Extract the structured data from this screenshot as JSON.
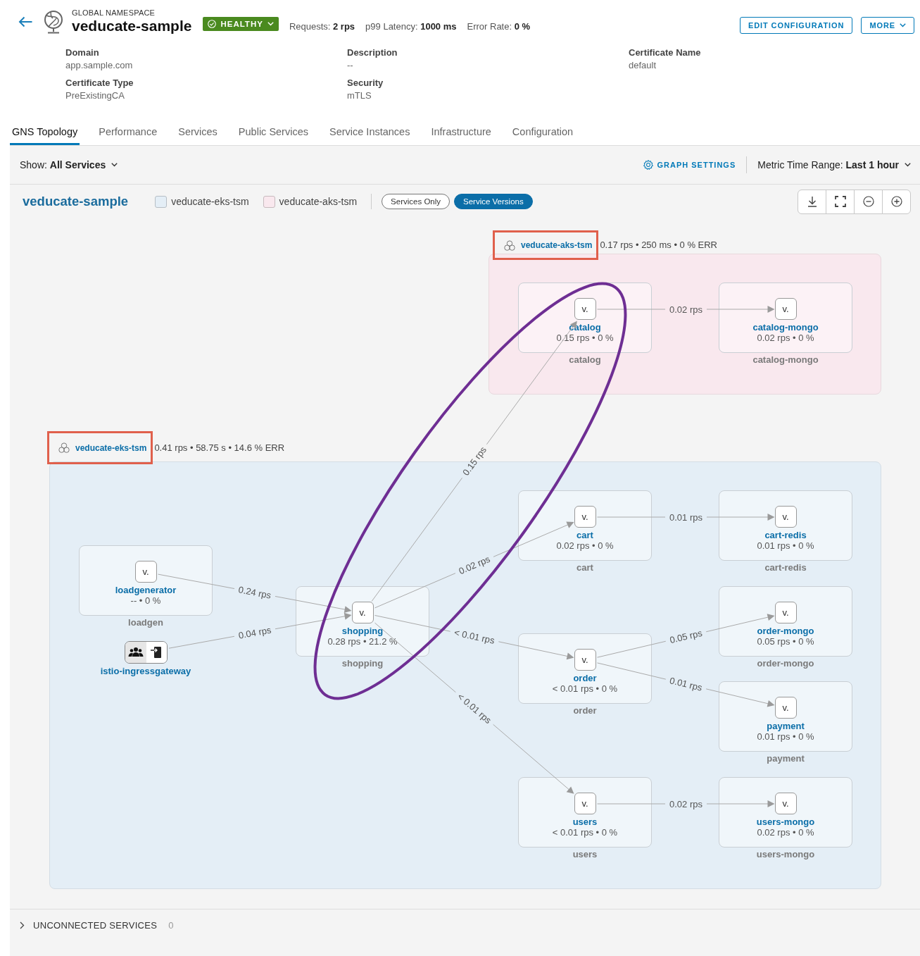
{
  "header": {
    "kicker": "GLOBAL NAMESPACE",
    "title": "veducate-sample",
    "health": {
      "label": "HEALTHY"
    },
    "metrics": [
      "Requests: **2 rps**",
      "p99 Latency: **1000 ms**",
      "Error Rate: **0 %**"
    ],
    "actions": [
      {
        "label": "EDIT CONFIGURATION",
        "dropdown": false
      },
      {
        "label": "MORE",
        "dropdown": true
      }
    ]
  },
  "details": [
    {
      "label": "Domain",
      "value": "app.sample.com"
    },
    {
      "label": "Description",
      "value": "--"
    },
    {
      "label": "Certificate Name",
      "value": "default"
    },
    {
      "label": "Certificate Type",
      "value": "PreExistingCA"
    },
    {
      "label": "Security",
      "value": "mTLS"
    }
  ],
  "tabs": [
    {
      "label": "GNS Topology",
      "selected": true
    },
    {
      "label": "Performance",
      "selected": false
    },
    {
      "label": "Services",
      "selected": false
    },
    {
      "label": "Public Services",
      "selected": false
    },
    {
      "label": "Service Instances",
      "selected": false
    },
    {
      "label": "Infrastructure",
      "selected": false
    },
    {
      "label": "Configuration",
      "selected": false
    }
  ],
  "toolbar": {
    "show": "Show: **All Services**",
    "settings": "GRAPH SETTINGS",
    "time_range": "Metric Time Range: **Last 1 hour**"
  },
  "legend": {
    "title": "veducate-sample",
    "clusters": [
      {
        "name": "veducate-eks-tsm",
        "color": "#e4eef6"
      },
      {
        "name": "veducate-aks-tsm",
        "color": "#f9e8ee"
      }
    ],
    "views": [
      {
        "label": "Services Only",
        "selected": false
      },
      {
        "label": "Service Versions",
        "selected": true
      }
    ]
  },
  "graph": {
    "clusters": [
      {
        "name": "veducate-aks-tsm",
        "stats": "0.17 rps • 250 ms • 0 % ERR",
        "highlighted": true,
        "color": "#f9e8ee",
        "nodes": [
          {
            "kind": "service",
            "version": "v.",
            "name": "catalog",
            "stats": "0.15 rps • 0 %",
            "caption": "catalog"
          },
          {
            "kind": "service",
            "version": "v.",
            "name": "catalog-mongo",
            "stats": "0.02 rps • 0 %",
            "caption": "catalog-mongo"
          }
        ]
      },
      {
        "name": "veducate-eks-tsm",
        "stats": "0.41 rps • 58.75 s • 14.6 % ERR",
        "highlighted": true,
        "color": "#e4eef6",
        "nodes": [
          {
            "kind": "service",
            "version": "v.",
            "name": "loadgenerator",
            "stats": "-- • 0 %",
            "caption": "loadgen"
          },
          {
            "kind": "gateway",
            "name": "istio-ingressgateway"
          },
          {
            "kind": "service",
            "version": "v.",
            "name": "shopping",
            "stats": "0.28 rps • 21.2 %",
            "caption": "shopping"
          },
          {
            "kind": "service",
            "version": "v.",
            "name": "cart",
            "stats": "0.02 rps • 0 %",
            "caption": "cart"
          },
          {
            "kind": "service",
            "version": "v.",
            "name": "cart-redis",
            "stats": "0.01 rps • 0 %",
            "caption": "cart-redis"
          },
          {
            "kind": "service",
            "version": "v.",
            "name": "order",
            "stats": "< 0.01 rps • 0 %",
            "caption": "order"
          },
          {
            "kind": "service",
            "version": "v.",
            "name": "order-mongo",
            "stats": "0.05 rps • 0 %",
            "caption": "order-mongo"
          },
          {
            "kind": "service",
            "version": "v.",
            "name": "payment",
            "stats": "0.01 rps • 0 %",
            "caption": "payment"
          },
          {
            "kind": "service",
            "version": "v.",
            "name": "users",
            "stats": "< 0.01 rps • 0 %",
            "caption": "users"
          },
          {
            "kind": "service",
            "version": "v.",
            "name": "users-mongo",
            "stats": "0.02 rps • 0 %",
            "caption": "users-mongo"
          }
        ]
      }
    ],
    "edges": [
      {
        "label": "0.02 rps"
      },
      {
        "label": "0.24 rps"
      },
      {
        "label": "0.04 rps"
      },
      {
        "label": "0.15 rps"
      },
      {
        "label": "0.02 rps"
      },
      {
        "label": "< 0.01 rps"
      },
      {
        "label": "< 0.01 rps"
      },
      {
        "label": "0.01 rps"
      },
      {
        "label": "0.05 rps"
      },
      {
        "label": "0.01 rps"
      },
      {
        "label": "0.02 rps"
      }
    ],
    "annotations": [
      {
        "kind": "ellipse"
      }
    ]
  },
  "unconnected": {
    "label": "UNCONNECTED SERVICES",
    "count": "0",
    "expanded": false
  }
}
